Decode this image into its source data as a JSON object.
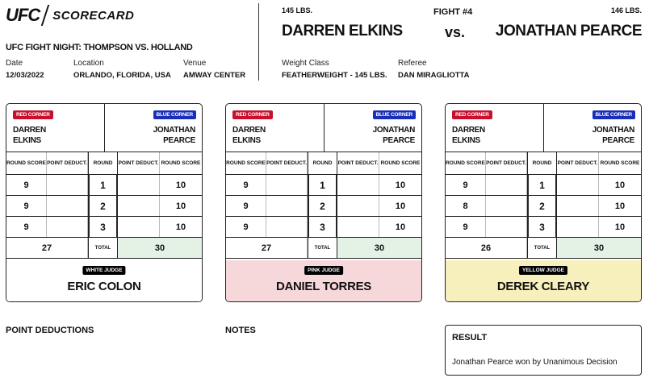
{
  "header": {
    "brand": "UFC",
    "doc_title": "SCORECARD",
    "event": "UFC FIGHT NIGHT: THOMPSON VS. HOLLAND",
    "date_label": "Date",
    "date": "12/03/2022",
    "location_label": "Location",
    "location": "ORLANDO, FLORIDA, USA",
    "venue_label": "Venue",
    "venue": "AMWAY CENTER"
  },
  "bout": {
    "fighter1_weight": "145 LBS.",
    "fight_number": "FIGHT #4",
    "fighter2_weight": "146 LBS.",
    "fighter1": "DARREN ELKINS",
    "vs": "vs.",
    "fighter2": "JONATHAN PEARCE",
    "weight_class_label": "Weight Class",
    "weight_class": "FEATHERWEIGHT - 145 LBS.",
    "referee_label": "Referee",
    "referee": "DAN MIRAGLIOTTA"
  },
  "labels": {
    "red_corner": "RED CORNER",
    "blue_corner": "BLUE CORNER",
    "red_first": "DARREN",
    "red_last": "ELKINS",
    "blue_first": "JONATHAN",
    "blue_last": "PEARCE",
    "round_score": "ROUND SCORE",
    "point_deduct": "POINT DEDUCT.",
    "round": "ROUND",
    "total": "TOTAL"
  },
  "cards": [
    {
      "judge_badge": "WHITE JUDGE",
      "judge": "ERIC COLON",
      "judge_color": "#ffffff",
      "rounds": [
        {
          "round": "1",
          "red": "9",
          "blue": "10"
        },
        {
          "round": "2",
          "red": "9",
          "blue": "10"
        },
        {
          "round": "3",
          "red": "9",
          "blue": "10"
        }
      ],
      "red_total": "27",
      "blue_total": "30"
    },
    {
      "judge_badge": "PINK JUDGE",
      "judge": "DANIEL TORRES",
      "judge_color": "#f6d7da",
      "rounds": [
        {
          "round": "1",
          "red": "9",
          "blue": "10"
        },
        {
          "round": "2",
          "red": "9",
          "blue": "10"
        },
        {
          "round": "3",
          "red": "9",
          "blue": "10"
        }
      ],
      "red_total": "27",
      "blue_total": "30"
    },
    {
      "judge_badge": "YELLOW JUDGE",
      "judge": "DEREK CLEARY",
      "judge_color": "#f8f0bc",
      "rounds": [
        {
          "round": "1",
          "red": "9",
          "blue": "10"
        },
        {
          "round": "2",
          "red": "8",
          "blue": "10"
        },
        {
          "round": "3",
          "red": "9",
          "blue": "10"
        }
      ],
      "red_total": "26",
      "blue_total": "30"
    }
  ],
  "footer": {
    "point_deductions": "POINT DEDUCTIONS",
    "notes": "NOTES",
    "result_title": "RESULT",
    "result_text": "Jonathan Pearce won by Unanimous Decision"
  },
  "colors": {
    "red_corner": "#c8102e",
    "blue_corner": "#1a2fb8",
    "blue_total_bg": "#e4f2e6"
  }
}
